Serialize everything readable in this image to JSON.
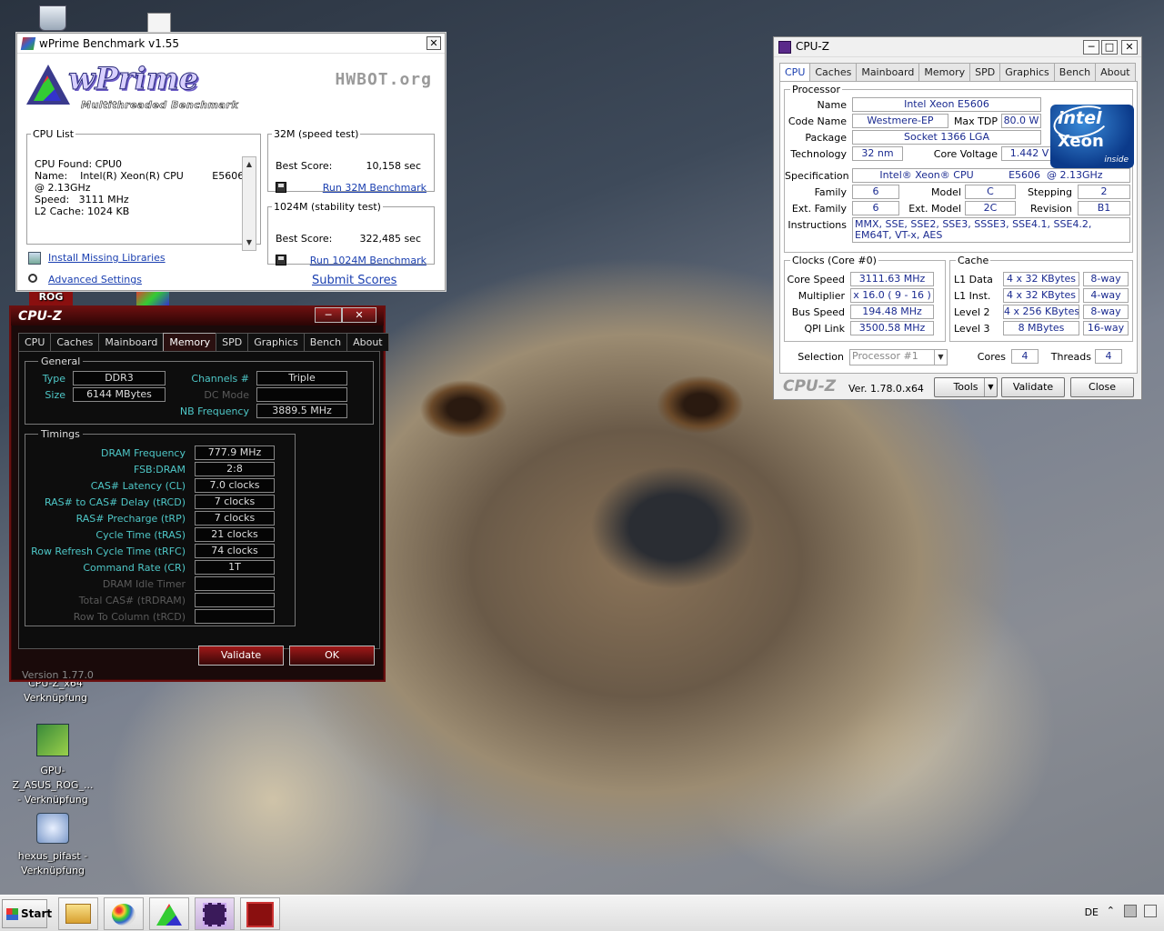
{
  "desktop": {
    "icons": [
      {
        "label": "",
        "icon": "recycle-bin-icon"
      },
      {
        "label": "",
        "icon": "java-app-icon"
      },
      {
        "label": "CPU-Z...\nVerknüpfung",
        "icon": "shortcut-icon"
      },
      {
        "label": "GPU-Z_ASUS_ROG_...\n- Verknüpfung",
        "icon": "gpu-z-icon"
      },
      {
        "label": "hexus_pifast -\nVerknüpfung",
        "icon": "pifast-icon"
      }
    ]
  },
  "wprime": {
    "title": "wPrime Benchmark v1.55",
    "logo_text": "wPrime",
    "logo_sub": "Multithreaded Benchmark",
    "hwbot": "HWBOT.org",
    "cpu_list": {
      "legend": "CPU List",
      "lines": [
        "CPU Found: CPU0",
        "Name:    Intel(R) Xeon(R) CPU         E5606",
        "@ 2.13GHz",
        "Speed:   3111 MHz",
        "L2 Cache: 1024 KB"
      ]
    },
    "test32": {
      "legend": "32M (speed test)",
      "best_label": "Best Score:",
      "best_value": "10,158 sec",
      "run": "Run 32M Benchmark"
    },
    "test1024": {
      "legend": "1024M (stability test)",
      "best_label": "Best Score:",
      "best_value": "322,485 sec",
      "run": "Run 1024M Benchmark"
    },
    "install_libraries": "Install Missing Libraries",
    "advanced_settings": "Advanced Settings",
    "submit_scores": "Submit Scores"
  },
  "cpuz_red": {
    "title": "CPU-Z",
    "tabs": [
      "CPU",
      "Caches",
      "Mainboard",
      "Memory",
      "SPD",
      "Graphics",
      "Bench",
      "About"
    ],
    "active_tab": "Memory",
    "general": {
      "legend": "General",
      "type_label": "Type",
      "type": "DDR3",
      "size_label": "Size",
      "size": "6144 MBytes",
      "channels_label": "Channels #",
      "channels": "Triple",
      "dcmode_label": "DC Mode",
      "dcmode": "",
      "nbfreq_label": "NB Frequency",
      "nbfreq": "3889.5 MHz"
    },
    "timings": {
      "legend": "Timings",
      "rows": [
        {
          "label": "DRAM Frequency",
          "value": "777.9 MHz"
        },
        {
          "label": "FSB:DRAM",
          "value": "2:8"
        },
        {
          "label": "CAS# Latency (CL)",
          "value": "7.0 clocks"
        },
        {
          "label": "RAS# to CAS# Delay (tRCD)",
          "value": "7 clocks"
        },
        {
          "label": "RAS# Precharge (tRP)",
          "value": "7 clocks"
        },
        {
          "label": "Cycle Time (tRAS)",
          "value": "21 clocks"
        },
        {
          "label": "Row Refresh Cycle Time (tRFC)",
          "value": "74 clocks"
        },
        {
          "label": "Command Rate (CR)",
          "value": "1T"
        },
        {
          "label": "DRAM Idle Timer",
          "value": ""
        },
        {
          "label": "Total CAS# (tRDRAM)",
          "value": ""
        },
        {
          "label": "Row To Column (tRCD)",
          "value": ""
        }
      ]
    },
    "validate": "Validate",
    "ok": "OK",
    "version": "Version 1.77.0"
  },
  "cpuz": {
    "title": "CPU-Z",
    "tabs": [
      "CPU",
      "Caches",
      "Mainboard",
      "Memory",
      "SPD",
      "Graphics",
      "Bench",
      "About"
    ],
    "active_tab": "CPU",
    "processor": {
      "legend": "Processor",
      "name_label": "Name",
      "name": "Intel Xeon E5606",
      "codename_label": "Code Name",
      "codename": "Westmere-EP",
      "maxtdp_label": "Max TDP",
      "maxtdp": "80.0 W",
      "package_label": "Package",
      "package": "Socket 1366 LGA",
      "tech_label": "Technology",
      "tech": "32 nm",
      "voltage_label": "Core Voltage",
      "voltage": "1.442 V",
      "spec_label": "Specification",
      "spec": "Intel® Xeon® CPU           E5606  @ 2.13GHz",
      "family_label": "Family",
      "family": "6",
      "model_label": "Model",
      "model": "C",
      "stepping_label": "Stepping",
      "stepping": "2",
      "extfamily_label": "Ext. Family",
      "extfamily": "6",
      "extmodel_label": "Ext. Model",
      "extmodel": "2C",
      "revision_label": "Revision",
      "revision": "B1",
      "instr_label": "Instructions",
      "instr": "MMX, SSE, SSE2, SSE3, SSSE3, SSE4.1, SSE4.2, EM64T, VT-x, AES",
      "badge": {
        "brand": "intel",
        "product": "Xeon",
        "tag": "inside"
      }
    },
    "clocks": {
      "legend": "Clocks (Core #0)",
      "corespeed_label": "Core Speed",
      "corespeed": "3111.63 MHz",
      "mult_label": "Multiplier",
      "mult": "x 16.0 ( 9 - 16 )",
      "bus_label": "Bus Speed",
      "bus": "194.48 MHz",
      "qpi_label": "QPI Link",
      "qpi": "3500.58 MHz"
    },
    "cache": {
      "legend": "Cache",
      "rows": [
        {
          "label": "L1 Data",
          "size": "4 x 32 KBytes",
          "way": "8-way"
        },
        {
          "label": "L1 Inst.",
          "size": "4 x 32 KBytes",
          "way": "4-way"
        },
        {
          "label": "Level 2",
          "size": "4 x 256 KBytes",
          "way": "8-way"
        },
        {
          "label": "Level 3",
          "size": "8 MBytes",
          "way": "16-way"
        }
      ]
    },
    "selection_label": "Selection",
    "selection": "Processor #1",
    "cores_label": "Cores",
    "cores": "4",
    "threads_label": "Threads",
    "threads": "4",
    "brand": "CPU-Z",
    "version": "Ver. 1.78.0.x64",
    "tools": "Tools",
    "validate": "Validate",
    "close": "Close"
  },
  "taskbar": {
    "start": "Start",
    "lang": "DE"
  }
}
